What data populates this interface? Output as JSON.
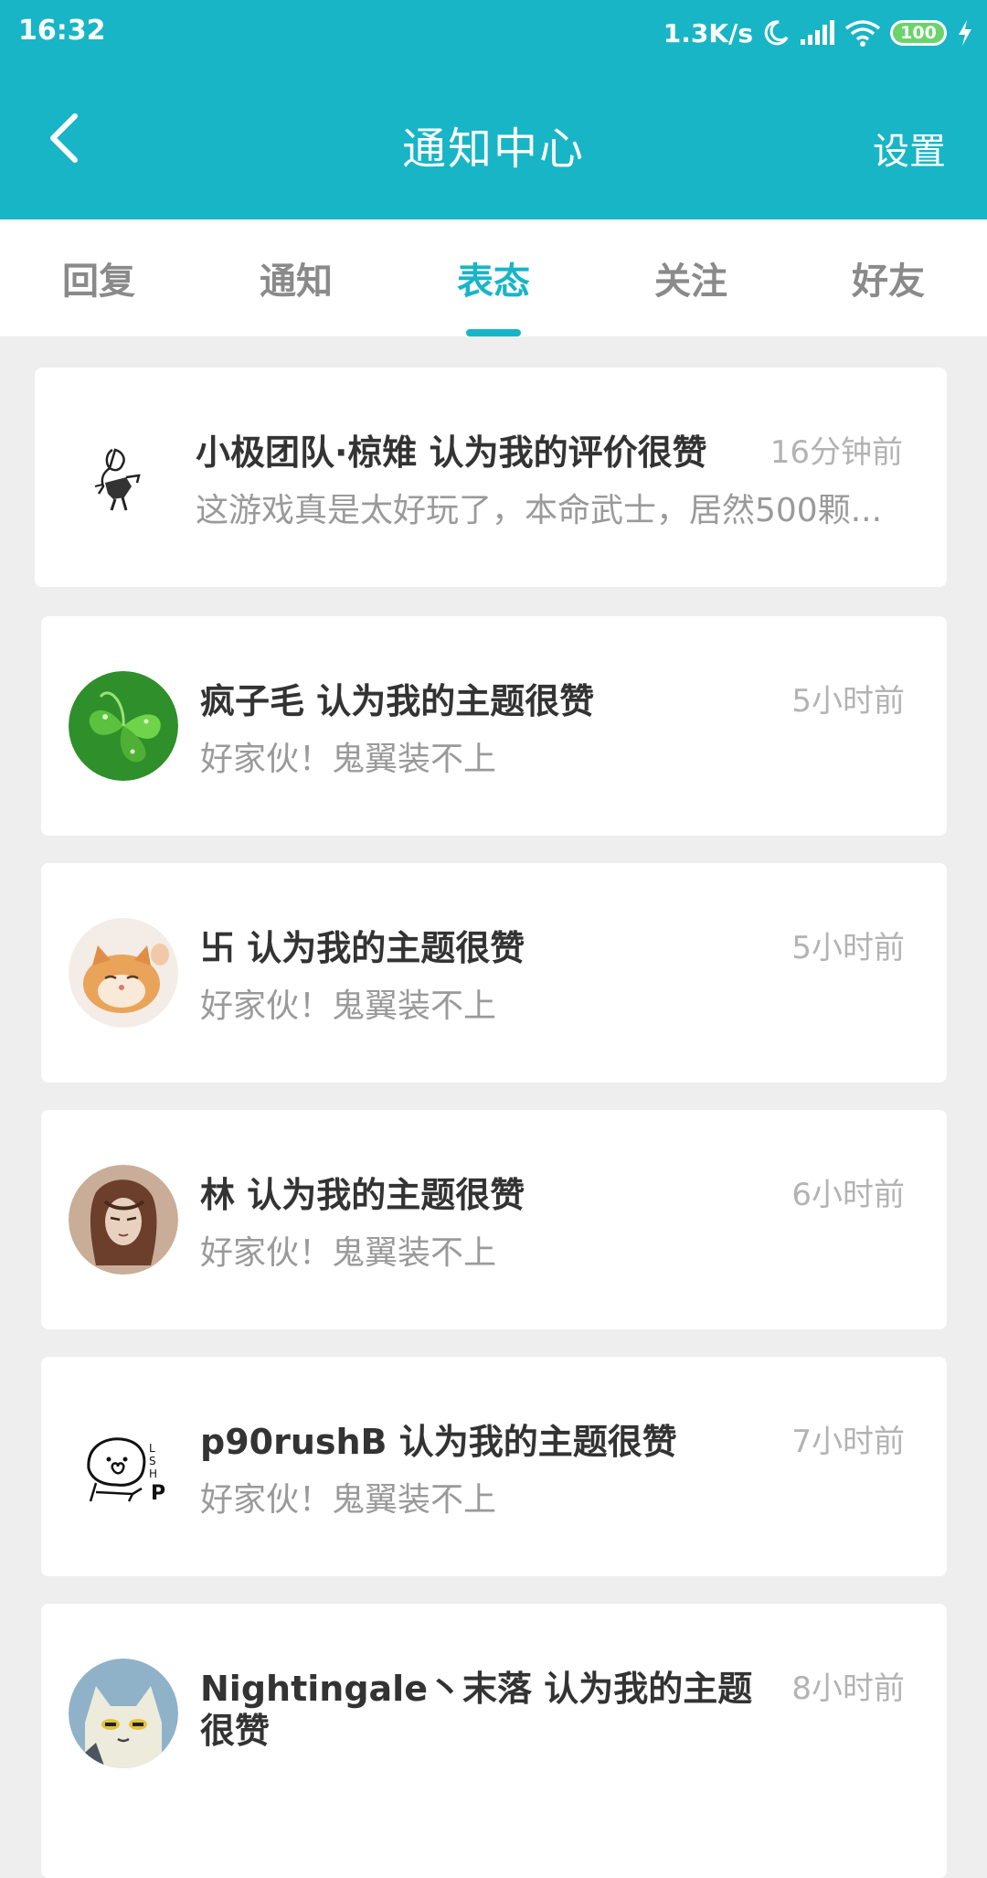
{
  "status_bar": {
    "time": "16:32",
    "speed": "1.3K/s",
    "battery": "100"
  },
  "header": {
    "title": "通知中心",
    "settings_label": "设置"
  },
  "tabs": [
    {
      "label": "回复",
      "active": false
    },
    {
      "label": "通知",
      "active": false
    },
    {
      "label": "表态",
      "active": true
    },
    {
      "label": "关注",
      "active": false
    },
    {
      "label": "好友",
      "active": false
    }
  ],
  "notifications": [
    {
      "title": "小极团队·椋雉 认为我的评价很赞",
      "time": "16分钟前",
      "snippet": "这游戏真是太好玩了，本命武士，居然500颗..."
    },
    {
      "title": "疯子毛 认为我的主题很赞",
      "time": "5小时前",
      "snippet": "好家伙！鬼翼装不上"
    },
    {
      "title": "卐 认为我的主题很赞",
      "time": "5小时前",
      "snippet": "好家伙！鬼翼装不上"
    },
    {
      "title": "林 认为我的主题很赞",
      "time": "6小时前",
      "snippet": "好家伙！鬼翼装不上"
    },
    {
      "title": "p90rushB 认为我的主题很赞",
      "time": "7小时前",
      "snippet": "好家伙！鬼翼装不上"
    },
    {
      "title_line1": "Nightingale丶末落 认为我的主题",
      "title_line2": "很赞",
      "time": "8小时前"
    }
  ],
  "colors": {
    "primary": "#18b5c6",
    "background": "#eeeeee"
  }
}
